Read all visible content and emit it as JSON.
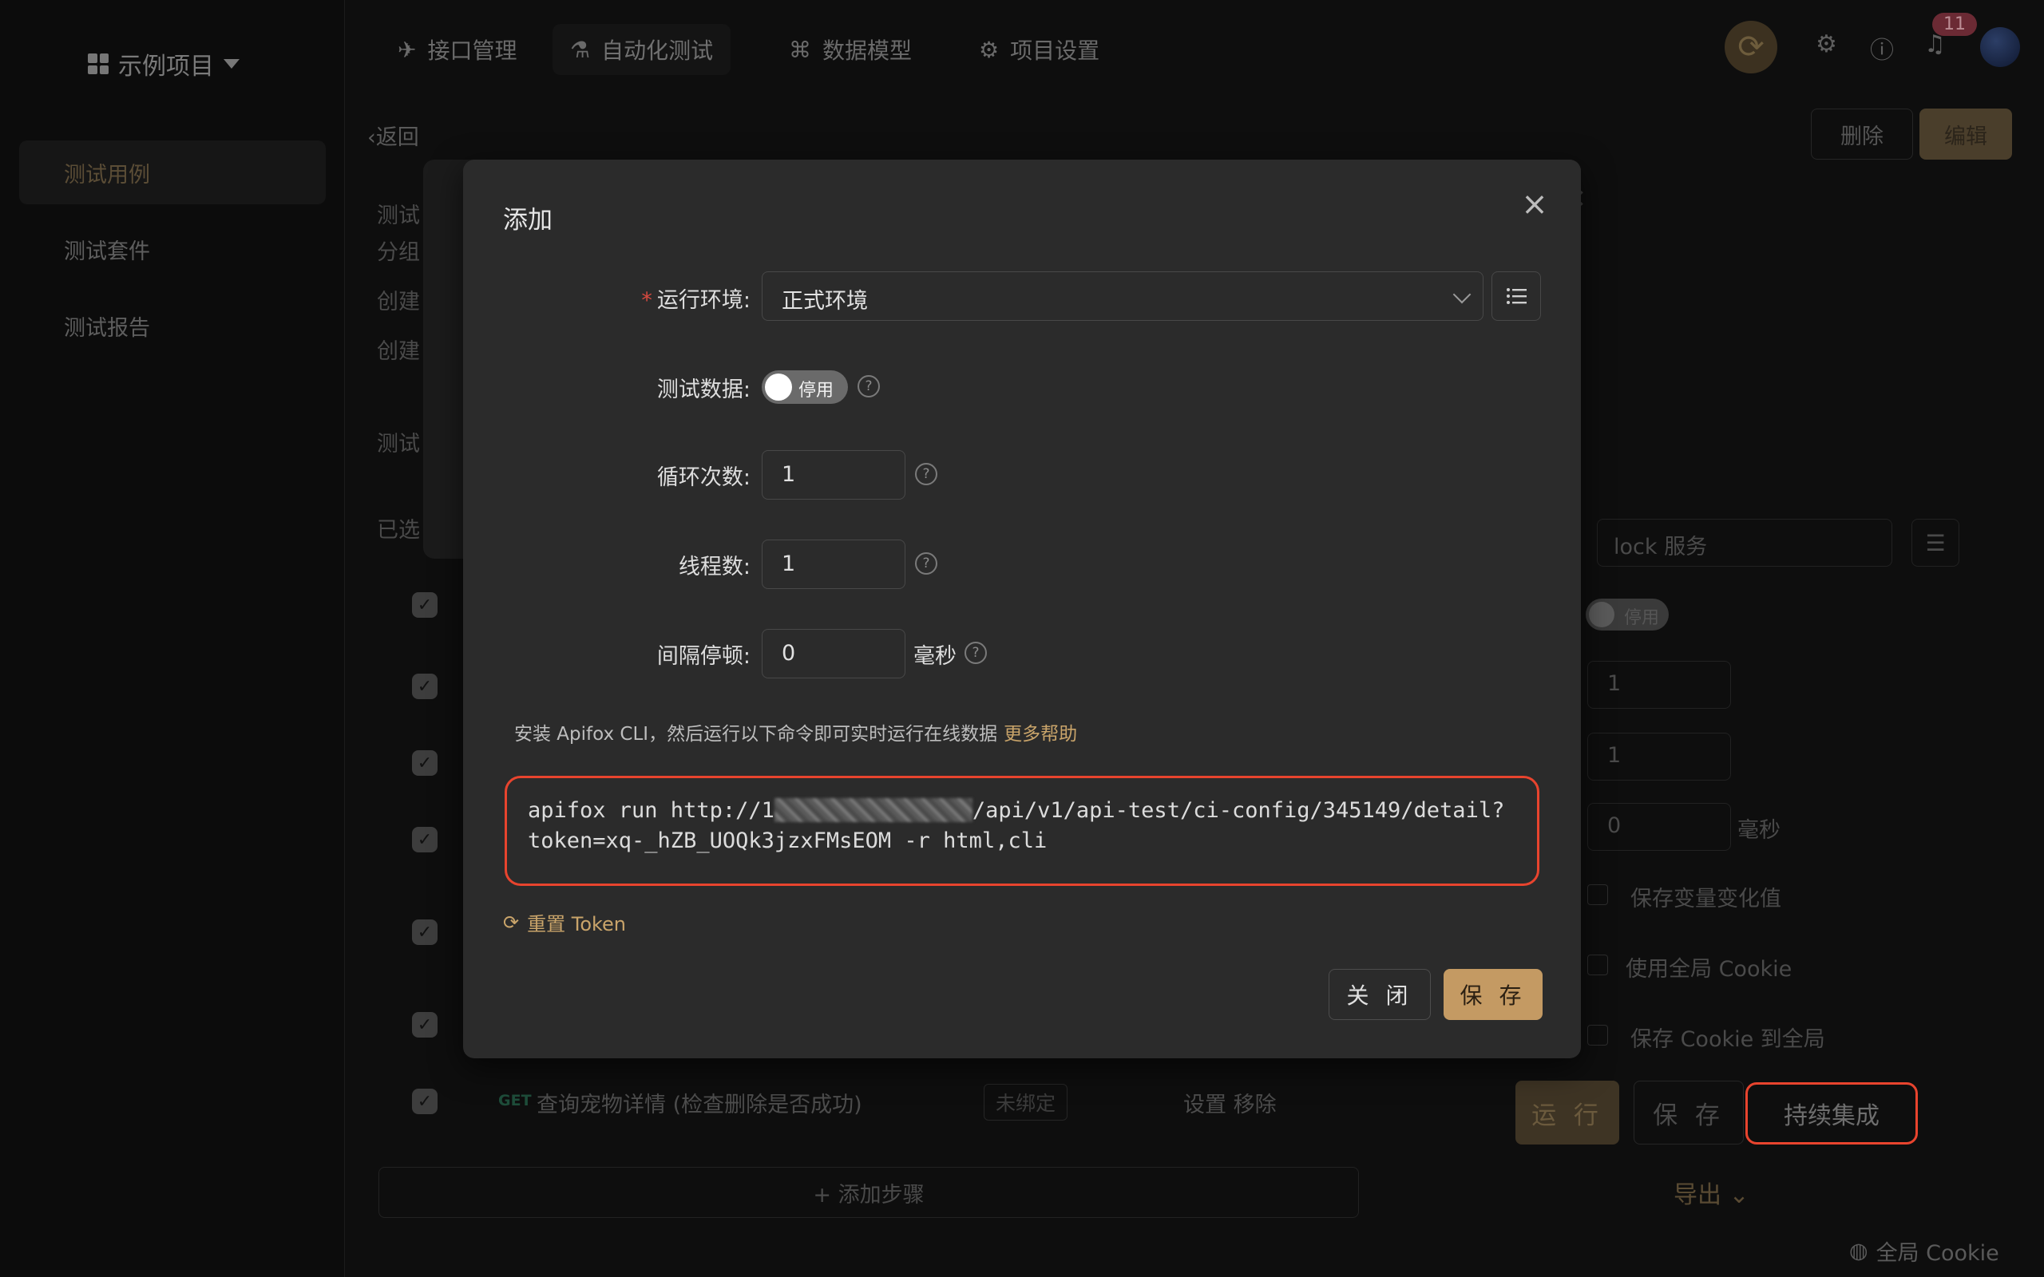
{
  "app": {
    "project_name": "示例项目",
    "top_tabs": [
      {
        "label": "接口管理",
        "icon": "rocket-icon"
      },
      {
        "label": "自动化测试",
        "icon": "flask-icon"
      },
      {
        "label": "数据模型",
        "icon": "model-icon"
      },
      {
        "label": "项目设置",
        "icon": "gear-icon"
      }
    ],
    "notification_count": "11",
    "sidebar": [
      {
        "label": "测试用例",
        "active": true
      },
      {
        "label": "测试套件",
        "active": false
      },
      {
        "label": "测试报告",
        "active": false
      }
    ],
    "back_label": "返回",
    "delete_label": "删除",
    "edit_label": "编辑",
    "bg_fields": [
      "测试",
      "分组",
      "创建",
      "创建"
    ],
    "bg_tab": "测试",
    "bg_selected": "已选",
    "last_step": {
      "method": "GET",
      "name": "查询宠物详情 (检查删除是否成功)",
      "binding": "未绑定",
      "actions": "设置  移除"
    },
    "add_step_label": "+ 添加步骤",
    "right_panel": {
      "env_value": "lock 服务",
      "toggle_label": "停用",
      "loop_count": "1",
      "threads": "1",
      "interval": "0",
      "interval_unit": "毫秒",
      "options": [
        "保存变量变化值",
        "使用全局 Cookie",
        "保存 Cookie 到全局"
      ],
      "run_label": "运 行",
      "save_label": "保 存",
      "ci_label": "持续集成",
      "export_label": "导出"
    },
    "global_cookie_label": "全局 Cookie"
  },
  "modal": {
    "title": "添加",
    "env_label": "运行环境:",
    "env_value": "正式环境",
    "test_data_label": "测试数据:",
    "test_data_toggle": "停用",
    "loop_label": "循环次数:",
    "loop_value": "1",
    "threads_label": "线程数:",
    "threads_value": "1",
    "interval_label": "间隔停顿:",
    "interval_value": "0",
    "interval_unit": "毫秒",
    "cli_hint": "安装 Apifox CLI，然后运行以下命令即可实时运行在线数据",
    "more_help": "更多帮助",
    "command_prefix": "apifox run http://1",
    "command_suffix": "/api/v1/api-test/ci-config/345149/detail?token=xq-_hZB_UOQk3jzxFMsEOM -r html,cli",
    "reset_token": "重置 Token",
    "close_button": "关 闭",
    "save_button": "保 存"
  },
  "colors": {
    "accent": "#c49a63",
    "highlight": "#e8442e",
    "modal_bg": "#2b2b2b"
  }
}
